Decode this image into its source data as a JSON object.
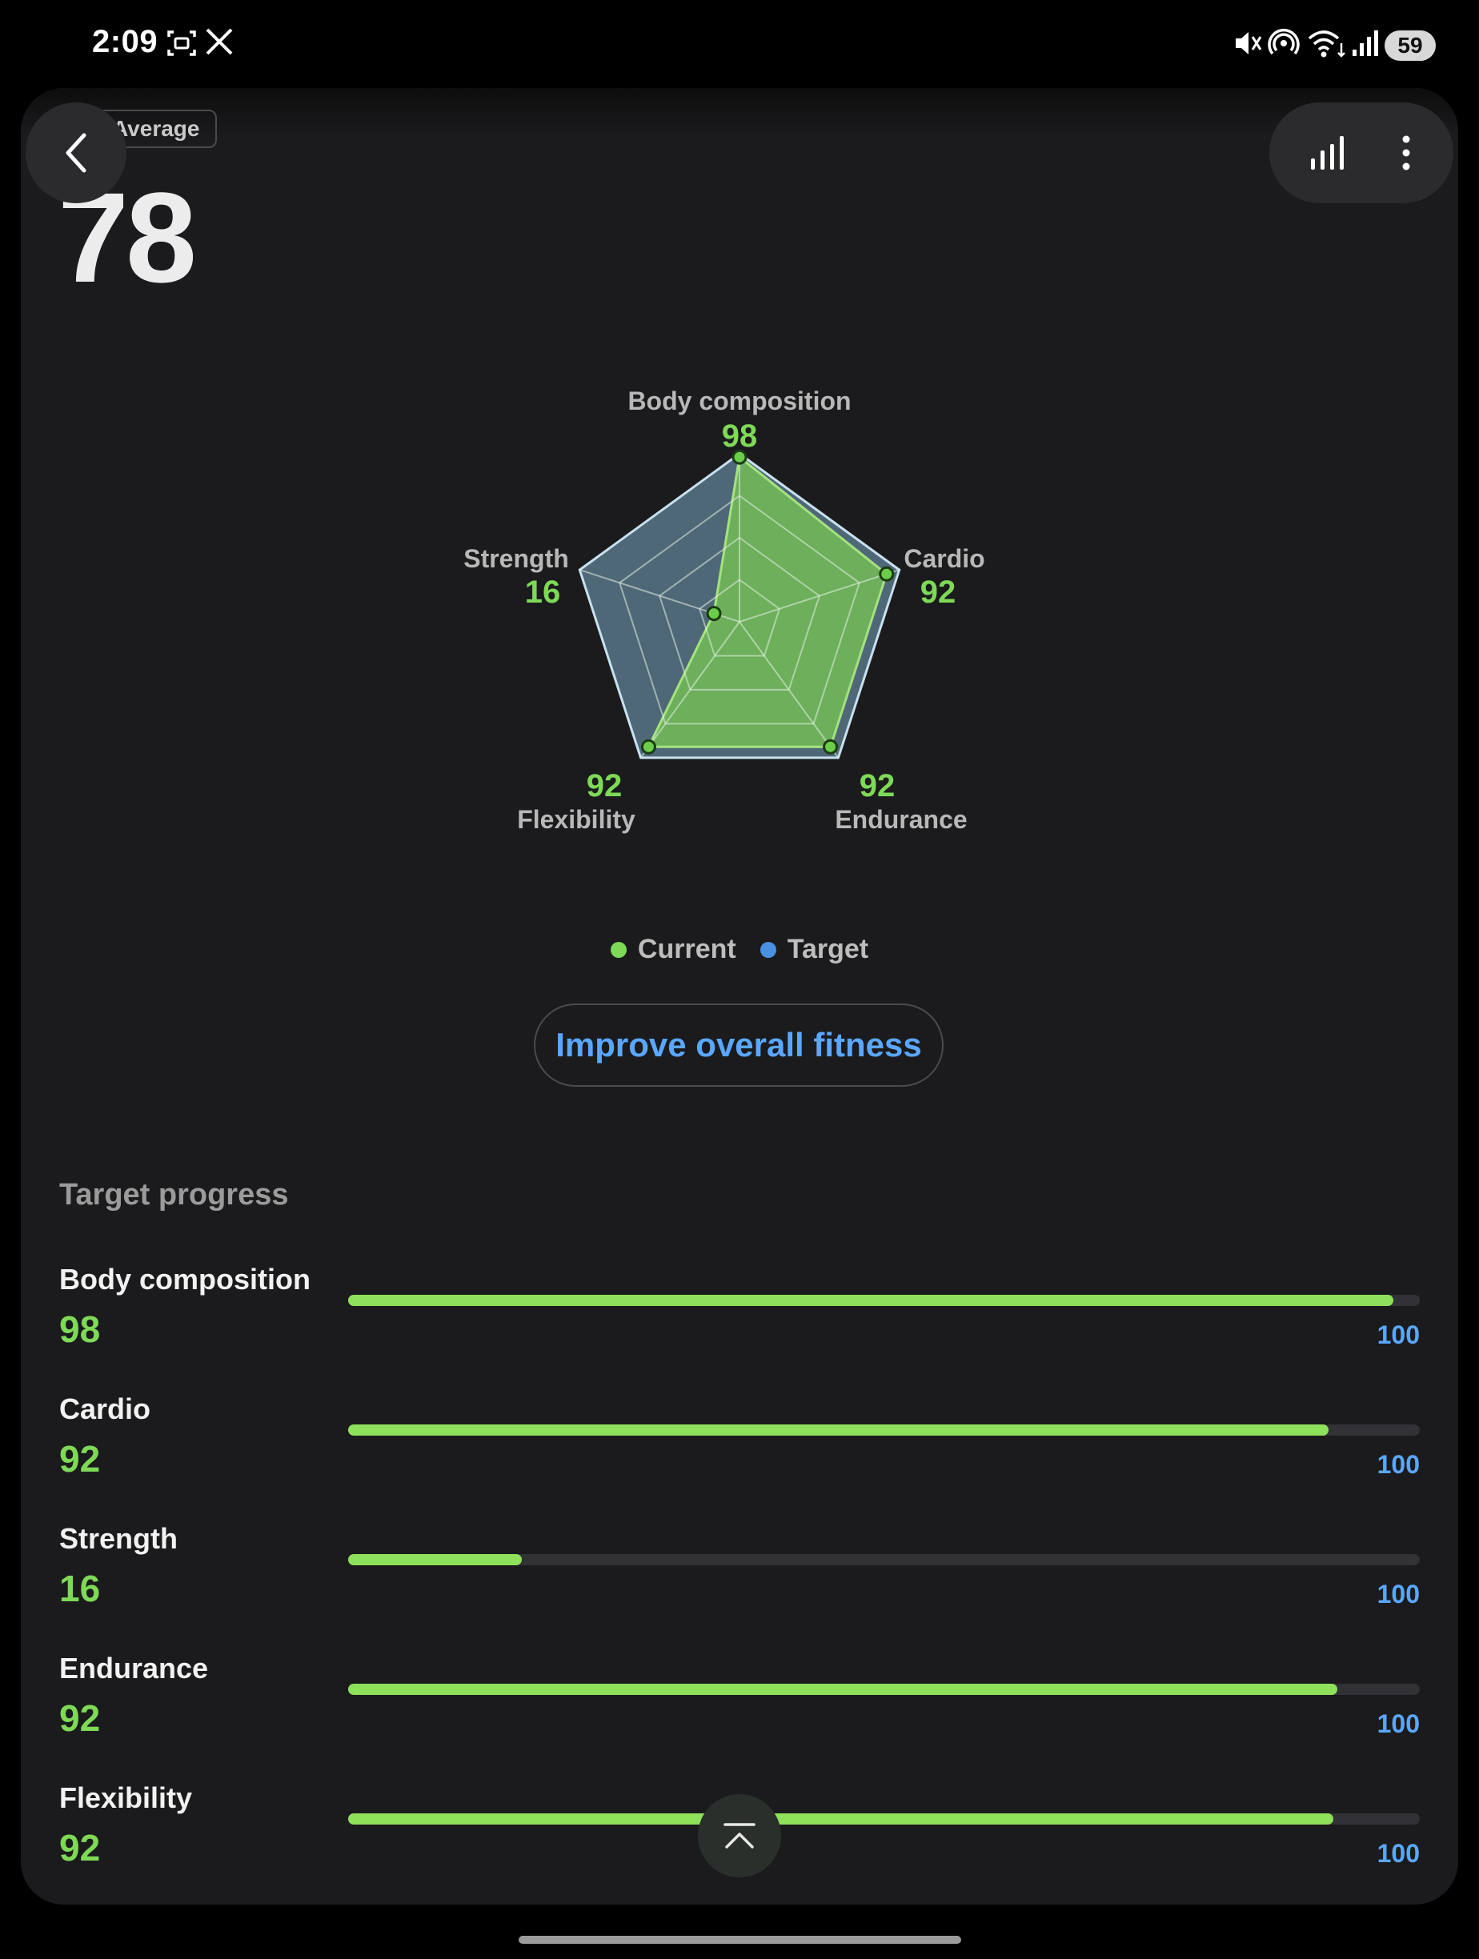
{
  "status_bar": {
    "time": "2:09",
    "battery": "59"
  },
  "header": {
    "badge": "Average",
    "score": "78"
  },
  "chart_data": {
    "type": "radar",
    "axes": [
      "Body composition",
      "Cardio",
      "Endurance",
      "Flexibility",
      "Strength"
    ],
    "series": [
      {
        "name": "Current",
        "values": [
          98,
          92,
          92,
          92,
          16
        ],
        "color": "#7ed957"
      },
      {
        "name": "Target",
        "values": [
          100,
          100,
          100,
          100,
          100
        ],
        "color": "#4a90e2"
      }
    ],
    "range": [
      0,
      100
    ],
    "labels": [
      {
        "axis": "Body composition",
        "value": "98"
      },
      {
        "axis": "Cardio",
        "value": "92"
      },
      {
        "axis": "Endurance",
        "value": "92"
      },
      {
        "axis": "Flexibility",
        "value": "92"
      },
      {
        "axis": "Strength",
        "value": "16"
      }
    ]
  },
  "legend": {
    "current": "Current",
    "target": "Target",
    "current_color": "#7ed957",
    "target_color": "#4a90e2"
  },
  "cta_label": "Improve overall fitness",
  "progress": {
    "title": "Target progress",
    "rows": [
      {
        "label": "Body composition",
        "value": "98",
        "target": "100",
        "fraction": 0.975
      },
      {
        "label": "Cardio",
        "value": "92",
        "target": "100",
        "fraction": 0.915
      },
      {
        "label": "Strength",
        "value": "16",
        "target": "100",
        "fraction": 0.162
      },
      {
        "label": "Endurance",
        "value": "92",
        "target": "100",
        "fraction": 0.923
      },
      {
        "label": "Flexibility",
        "value": "92",
        "target": "100",
        "fraction": 0.919
      }
    ]
  },
  "icons": {
    "back": "chevron-left-icon",
    "chart": "bar-chart-icon",
    "more": "more-vertical-icon",
    "scroll_top": "chevron-up-icon"
  }
}
